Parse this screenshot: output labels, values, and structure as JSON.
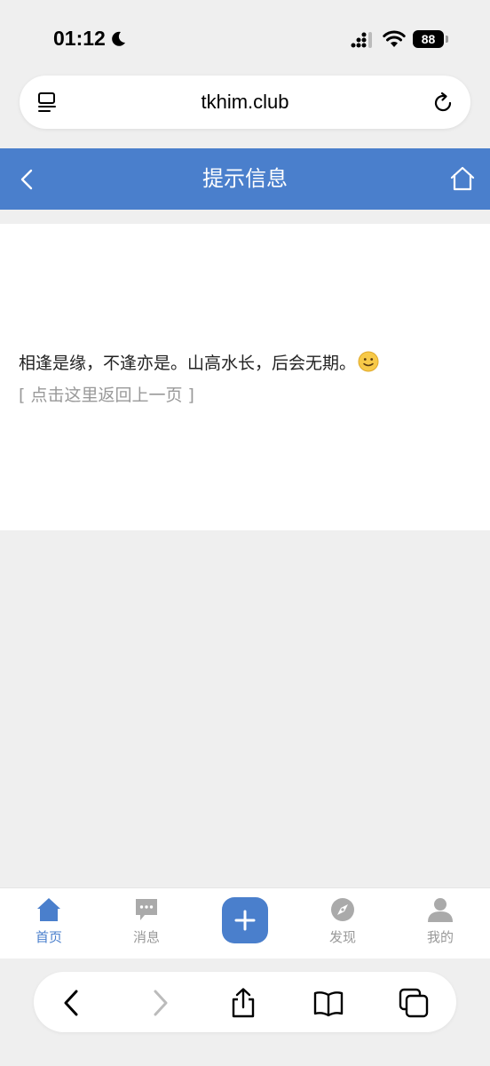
{
  "status_bar": {
    "time": "01:12",
    "battery": "88"
  },
  "browser": {
    "url": "tkhim.club"
  },
  "header": {
    "title": "提示信息"
  },
  "content": {
    "message": "相逢是缘，不逢亦是。山高水长，后会无期。",
    "return_link": "[ 点击这里返回上一页 ]"
  },
  "tab_bar": {
    "items": [
      {
        "label": "首页",
        "icon": "home-icon",
        "active": true
      },
      {
        "label": "消息",
        "icon": "chat-icon",
        "active": false
      },
      {
        "label": "发现",
        "icon": "compass-icon",
        "active": false
      },
      {
        "label": "我的",
        "icon": "user-icon",
        "active": false
      }
    ]
  },
  "colors": {
    "accent": "#4a7fcc",
    "inactive": "#999999",
    "background": "#efefef"
  }
}
